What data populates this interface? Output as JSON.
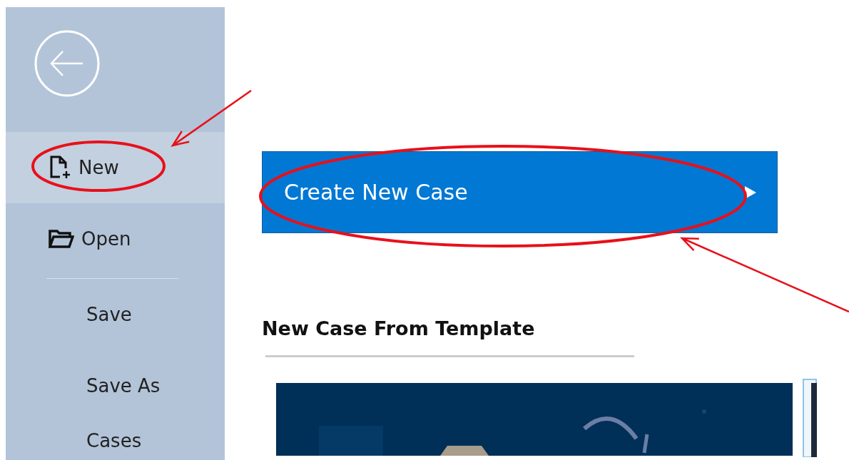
{
  "sidebar": {
    "back_button": {
      "kind": "arrow"
    },
    "items": [
      {
        "kind": "file",
        "label": "New",
        "selected": true
      },
      {
        "kind": "folder",
        "label": "Open",
        "selected": false
      },
      {
        "kind": "divider"
      },
      {
        "kind": "plain",
        "label": "Save",
        "selected": false
      },
      {
        "kind": "plain",
        "label": "Save As",
        "selected": false
      },
      {
        "kind": "plain",
        "label": "Cases",
        "selected": false
      }
    ]
  },
  "main": {
    "create_button": {
      "label": "Create New Case"
    },
    "template_section": {
      "heading": "New Case From Template"
    }
  },
  "annotations": [
    {
      "kind": "ellipse"
    },
    {
      "kind": "arrow"
    },
    {
      "kind": "ellipse"
    },
    {
      "kind": "arrow"
    }
  ]
}
